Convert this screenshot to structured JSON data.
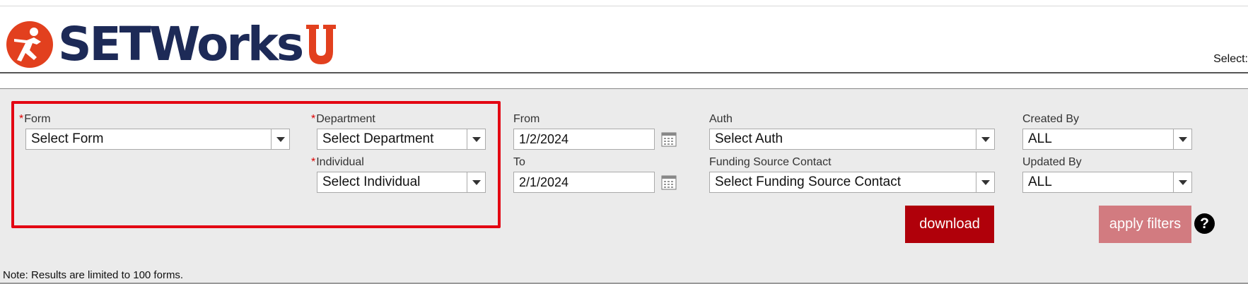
{
  "header": {
    "brand_name": "SETWorks",
    "brand_suffix": "U",
    "select_label": "Select:"
  },
  "filters": {
    "form": {
      "label": "Form",
      "value": "Select Form",
      "required": "*"
    },
    "department": {
      "label": "Department",
      "value": "Select Department",
      "required": "*"
    },
    "individual": {
      "label": "Individual",
      "value": "Select Individual",
      "required": "*"
    },
    "from": {
      "label": "From",
      "value": "1/2/2024"
    },
    "to": {
      "label": "To",
      "value": "2/1/2024"
    },
    "auth": {
      "label": "Auth",
      "value": "Select Auth"
    },
    "funding_source_contact": {
      "label": "Funding Source Contact",
      "value": "Select Funding Source Contact"
    },
    "created_by": {
      "label": "Created By",
      "value": "ALL"
    },
    "updated_by": {
      "label": "Updated By",
      "value": "ALL"
    }
  },
  "actions": {
    "download_label": "download",
    "apply_filters_label": "apply filters",
    "help_label": "?"
  },
  "note": "Note: Results are limited to 100 forms.",
  "colors": {
    "brand_navy": "#1d2a57",
    "brand_red": "#e2401e",
    "download_bg": "#b0000a",
    "apply_bg": "#d27b80",
    "highlight_border": "#e30613"
  }
}
